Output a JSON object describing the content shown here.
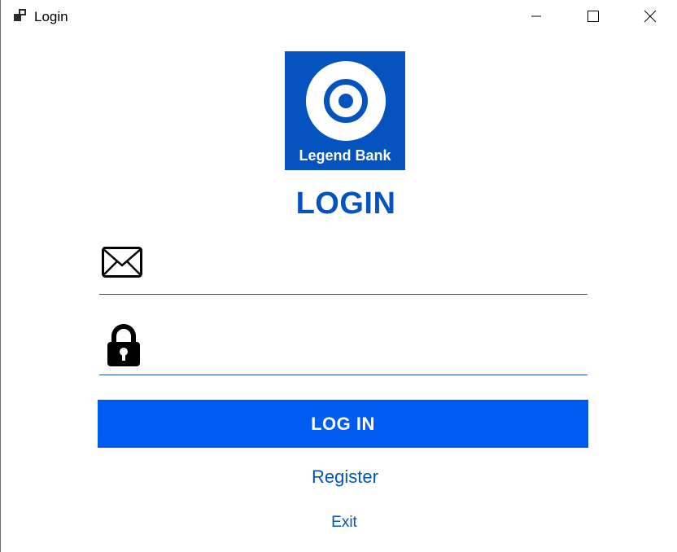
{
  "window": {
    "title": "Login"
  },
  "logo": {
    "text": "Legend Bank",
    "brand_color": "#0453be"
  },
  "heading": "LOGIN",
  "form": {
    "email": {
      "value": "",
      "icon": "envelope-icon"
    },
    "password": {
      "value": "",
      "icon": "lock-icon"
    },
    "login_button": "LOG IN",
    "register_link": "Register",
    "exit_link": "Exit"
  },
  "colors": {
    "accent": "#0453be",
    "button": "#005cf1"
  }
}
